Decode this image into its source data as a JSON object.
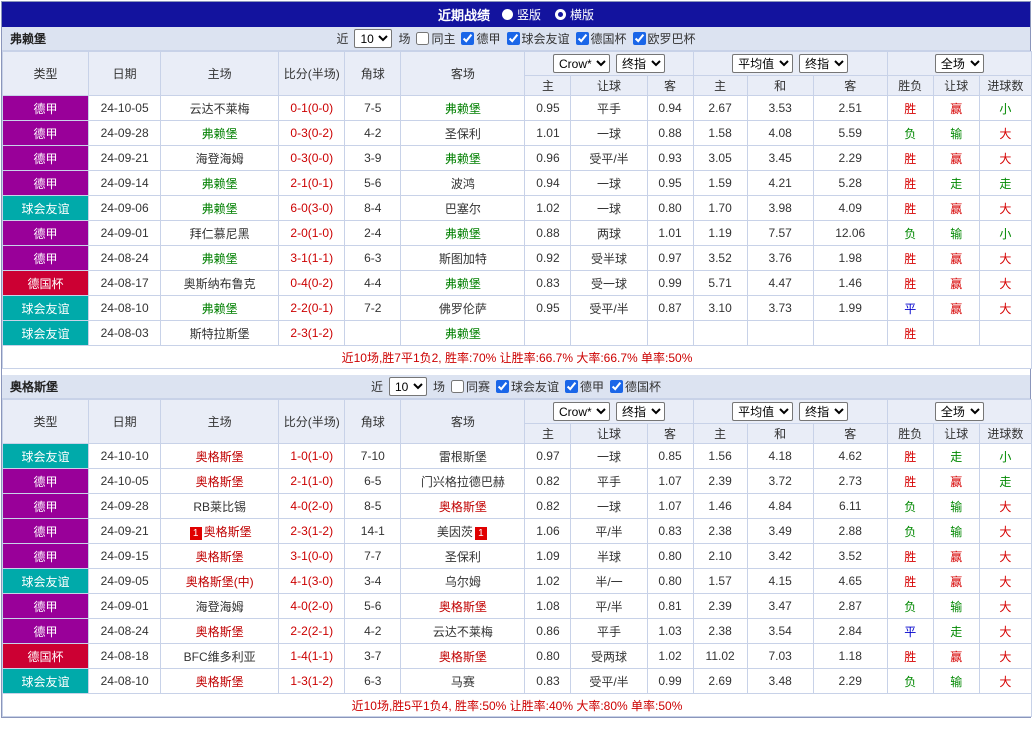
{
  "title_bar": {
    "title": "近期战绩",
    "radios": [
      {
        "label": "竖版",
        "selected": false
      },
      {
        "label": "横版",
        "selected": true
      }
    ]
  },
  "columns": {
    "type": "类型",
    "date": "日期",
    "home": "主场",
    "score": "比分(半场)",
    "corner": "角球",
    "away": "客场",
    "odds_home": "主",
    "odds_hand": "让球",
    "odds_away": "客",
    "eu_home": "主",
    "eu_draw": "和",
    "eu_away": "客",
    "res_wl": "胜负",
    "res_handicap": "让球",
    "res_goals": "进球数"
  },
  "selects": {
    "odds_company": "Crow*",
    "odds_stage": "终指",
    "eu_company": "平均值",
    "eu_stage": "终指",
    "scope": "全场"
  },
  "type_colors": {
    "德甲": "#990099",
    "球会友谊": "#00AAAA",
    "德国杯": "#CC0033"
  },
  "result_colors": {
    "red": "#D60000",
    "green": "#008800",
    "blue": "#0000CC"
  },
  "sections": [
    {
      "team": "弗赖堡",
      "focus_color": "#008000",
      "filter": {
        "prefix": "近",
        "count": "10",
        "suffix": "场",
        "same_label": "同主",
        "same_checked": false,
        "leagues": [
          {
            "label": "德甲",
            "checked": true
          },
          {
            "label": "球会友谊",
            "checked": true
          },
          {
            "label": "德国杯",
            "checked": true
          },
          {
            "label": "欧罗巴杯",
            "checked": true
          }
        ]
      },
      "rows": [
        {
          "type": "德甲",
          "date": "24-10-05",
          "home": "云达不莱梅",
          "home_focus": false,
          "home_badge": "",
          "score": "0-1(0-0)",
          "corner": "7-5",
          "away": "弗赖堡",
          "away_focus": true,
          "away_badge": "",
          "odds_home": "0.95",
          "odds_hand": "平手",
          "odds_away": "0.94",
          "eu_home": "2.67",
          "eu_draw": "3.53",
          "eu_away": "2.51",
          "res_wl": "胜",
          "res_wl_c": "red",
          "res_hd": "赢",
          "res_hd_c": "red",
          "res_gl": "小",
          "res_gl_c": "green"
        },
        {
          "type": "德甲",
          "date": "24-09-28",
          "home": "弗赖堡",
          "home_focus": true,
          "home_badge": "",
          "score": "0-3(0-2)",
          "corner": "4-2",
          "away": "圣保利",
          "away_focus": false,
          "away_badge": "",
          "odds_home": "1.01",
          "odds_hand": "一球",
          "odds_away": "0.88",
          "eu_home": "1.58",
          "eu_draw": "4.08",
          "eu_away": "5.59",
          "res_wl": "负",
          "res_wl_c": "green",
          "res_hd": "输",
          "res_hd_c": "green",
          "res_gl": "大",
          "res_gl_c": "red"
        },
        {
          "type": "德甲",
          "date": "24-09-21",
          "home": "海登海姆",
          "home_focus": false,
          "home_badge": "",
          "score": "0-3(0-0)",
          "corner": "3-9",
          "away": "弗赖堡",
          "away_focus": true,
          "away_badge": "",
          "odds_home": "0.96",
          "odds_hand": "受平/半",
          "odds_away": "0.93",
          "eu_home": "3.05",
          "eu_draw": "3.45",
          "eu_away": "2.29",
          "res_wl": "胜",
          "res_wl_c": "red",
          "res_hd": "赢",
          "res_hd_c": "red",
          "res_gl": "大",
          "res_gl_c": "red"
        },
        {
          "type": "德甲",
          "date": "24-09-14",
          "home": "弗赖堡",
          "home_focus": true,
          "home_badge": "",
          "score": "2-1(0-1)",
          "corner": "5-6",
          "away": "波鸿",
          "away_focus": false,
          "away_badge": "",
          "odds_home": "0.94",
          "odds_hand": "一球",
          "odds_away": "0.95",
          "eu_home": "1.59",
          "eu_draw": "4.21",
          "eu_away": "5.28",
          "res_wl": "胜",
          "res_wl_c": "red",
          "res_hd": "走",
          "res_hd_c": "green",
          "res_gl": "走",
          "res_gl_c": "green"
        },
        {
          "type": "球会友谊",
          "date": "24-09-06",
          "home": "弗赖堡",
          "home_focus": true,
          "home_badge": "",
          "score": "6-0(3-0)",
          "corner": "8-4",
          "away": "巴塞尔",
          "away_focus": false,
          "away_badge": "",
          "odds_home": "1.02",
          "odds_hand": "一球",
          "odds_away": "0.80",
          "eu_home": "1.70",
          "eu_draw": "3.98",
          "eu_away": "4.09",
          "res_wl": "胜",
          "res_wl_c": "red",
          "res_hd": "赢",
          "res_hd_c": "red",
          "res_gl": "大",
          "res_gl_c": "red"
        },
        {
          "type": "德甲",
          "date": "24-09-01",
          "home": "拜仁慕尼黑",
          "home_focus": false,
          "home_badge": "",
          "score": "2-0(1-0)",
          "corner": "2-4",
          "away": "弗赖堡",
          "away_focus": true,
          "away_badge": "",
          "odds_home": "0.88",
          "odds_hand": "两球",
          "odds_away": "1.01",
          "eu_home": "1.19",
          "eu_draw": "7.57",
          "eu_away": "12.06",
          "res_wl": "负",
          "res_wl_c": "green",
          "res_hd": "输",
          "res_hd_c": "green",
          "res_gl": "小",
          "res_gl_c": "green"
        },
        {
          "type": "德甲",
          "date": "24-08-24",
          "home": "弗赖堡",
          "home_focus": true,
          "home_badge": "",
          "score": "3-1(1-1)",
          "corner": "6-3",
          "away": "斯图加特",
          "away_focus": false,
          "away_badge": "",
          "odds_home": "0.92",
          "odds_hand": "受半球",
          "odds_away": "0.97",
          "eu_home": "3.52",
          "eu_draw": "3.76",
          "eu_away": "1.98",
          "res_wl": "胜",
          "res_wl_c": "red",
          "res_hd": "赢",
          "res_hd_c": "red",
          "res_gl": "大",
          "res_gl_c": "red"
        },
        {
          "type": "德国杯",
          "date": "24-08-17",
          "home": "奥斯纳布鲁克",
          "home_focus": false,
          "home_badge": "",
          "score": "0-4(0-2)",
          "corner": "4-4",
          "away": "弗赖堡",
          "away_focus": true,
          "away_badge": "",
          "odds_home": "0.83",
          "odds_hand": "受一球",
          "odds_away": "0.99",
          "eu_home": "5.71",
          "eu_draw": "4.47",
          "eu_away": "1.46",
          "res_wl": "胜",
          "res_wl_c": "red",
          "res_hd": "赢",
          "res_hd_c": "red",
          "res_gl": "大",
          "res_gl_c": "red"
        },
        {
          "type": "球会友谊",
          "date": "24-08-10",
          "home": "弗赖堡",
          "home_focus": true,
          "home_badge": "",
          "score": "2-2(0-1)",
          "corner": "7-2",
          "away": "佛罗伦萨",
          "away_focus": false,
          "away_badge": "",
          "odds_home": "0.95",
          "odds_hand": "受平/半",
          "odds_away": "0.87",
          "eu_home": "3.10",
          "eu_draw": "3.73",
          "eu_away": "1.99",
          "res_wl": "平",
          "res_wl_c": "blue",
          "res_hd": "赢",
          "res_hd_c": "red",
          "res_gl": "大",
          "res_gl_c": "red"
        },
        {
          "type": "球会友谊",
          "date": "24-08-03",
          "home": "斯特拉斯堡",
          "home_focus": false,
          "home_badge": "",
          "score": "2-3(1-2)",
          "corner": "",
          "away": "弗赖堡",
          "away_focus": true,
          "away_badge": "",
          "odds_home": "",
          "odds_hand": "",
          "odds_away": "",
          "eu_home": "",
          "eu_draw": "",
          "eu_away": "",
          "res_wl": "胜",
          "res_wl_c": "red",
          "res_hd": "",
          "res_hd_c": "",
          "res_gl": "",
          "res_gl_c": ""
        }
      ],
      "summary": "近10场,胜7平1负2, 胜率:70% 让胜率:66.7% 大率:66.7% 单率:50%"
    },
    {
      "team": "奥格斯堡",
      "focus_color": "#C00000",
      "filter": {
        "prefix": "近",
        "count": "10",
        "suffix": "场",
        "same_label": "同赛",
        "same_checked": false,
        "leagues": [
          {
            "label": "球会友谊",
            "checked": true
          },
          {
            "label": "德甲",
            "checked": true
          },
          {
            "label": "德国杯",
            "checked": true
          }
        ]
      },
      "rows": [
        {
          "type": "球会友谊",
          "date": "24-10-10",
          "home": "奥格斯堡",
          "home_focus": true,
          "home_badge": "",
          "score": "1-0(1-0)",
          "corner": "7-10",
          "away": "雷根斯堡",
          "away_focus": false,
          "away_badge": "",
          "odds_home": "0.97",
          "odds_hand": "一球",
          "odds_away": "0.85",
          "eu_home": "1.56",
          "eu_draw": "4.18",
          "eu_away": "4.62",
          "res_wl": "胜",
          "res_wl_c": "red",
          "res_hd": "走",
          "res_hd_c": "green",
          "res_gl": "小",
          "res_gl_c": "green"
        },
        {
          "type": "德甲",
          "date": "24-10-05",
          "home": "奥格斯堡",
          "home_focus": true,
          "home_badge": "",
          "score": "2-1(1-0)",
          "corner": "6-5",
          "away": "门兴格拉德巴赫",
          "away_focus": false,
          "away_badge": "",
          "odds_home": "0.82",
          "odds_hand": "平手",
          "odds_away": "1.07",
          "eu_home": "2.39",
          "eu_draw": "3.72",
          "eu_away": "2.73",
          "res_wl": "胜",
          "res_wl_c": "red",
          "res_hd": "赢",
          "res_hd_c": "red",
          "res_gl": "走",
          "res_gl_c": "green"
        },
        {
          "type": "德甲",
          "date": "24-09-28",
          "home": "RB莱比锡",
          "home_focus": false,
          "home_badge": "",
          "score": "4-0(2-0)",
          "corner": "8-5",
          "away": "奥格斯堡",
          "away_focus": true,
          "away_badge": "",
          "odds_home": "0.82",
          "odds_hand": "一球",
          "odds_away": "1.07",
          "eu_home": "1.46",
          "eu_draw": "4.84",
          "eu_away": "6.11",
          "res_wl": "负",
          "res_wl_c": "green",
          "res_hd": "输",
          "res_hd_c": "green",
          "res_gl": "大",
          "res_gl_c": "red"
        },
        {
          "type": "德甲",
          "date": "24-09-21",
          "home": "奥格斯堡",
          "home_focus": true,
          "home_badge": "1",
          "score": "2-3(1-2)",
          "corner": "14-1",
          "away": "美因茨",
          "away_focus": false,
          "away_badge": "1",
          "odds_home": "1.06",
          "odds_hand": "平/半",
          "odds_away": "0.83",
          "eu_home": "2.38",
          "eu_draw": "3.49",
          "eu_away": "2.88",
          "res_wl": "负",
          "res_wl_c": "green",
          "res_hd": "输",
          "res_hd_c": "green",
          "res_gl": "大",
          "res_gl_c": "red"
        },
        {
          "type": "德甲",
          "date": "24-09-15",
          "home": "奥格斯堡",
          "home_focus": true,
          "home_badge": "",
          "score": "3-1(0-0)",
          "corner": "7-7",
          "away": "圣保利",
          "away_focus": false,
          "away_badge": "",
          "odds_home": "1.09",
          "odds_hand": "半球",
          "odds_away": "0.80",
          "eu_home": "2.10",
          "eu_draw": "3.42",
          "eu_away": "3.52",
          "res_wl": "胜",
          "res_wl_c": "red",
          "res_hd": "赢",
          "res_hd_c": "red",
          "res_gl": "大",
          "res_gl_c": "red"
        },
        {
          "type": "球会友谊",
          "date": "24-09-05",
          "home": "奥格斯堡(中)",
          "home_focus": true,
          "home_badge": "",
          "score": "4-1(3-0)",
          "corner": "3-4",
          "away": "乌尔姆",
          "away_focus": false,
          "away_badge": "",
          "odds_home": "1.02",
          "odds_hand": "半/一",
          "odds_away": "0.80",
          "eu_home": "1.57",
          "eu_draw": "4.15",
          "eu_away": "4.65",
          "res_wl": "胜",
          "res_wl_c": "red",
          "res_hd": "赢",
          "res_hd_c": "red",
          "res_gl": "大",
          "res_gl_c": "red"
        },
        {
          "type": "德甲",
          "date": "24-09-01",
          "home": "海登海姆",
          "home_focus": false,
          "home_badge": "",
          "score": "4-0(2-0)",
          "corner": "5-6",
          "away": "奥格斯堡",
          "away_focus": true,
          "away_badge": "",
          "odds_home": "1.08",
          "odds_hand": "平/半",
          "odds_away": "0.81",
          "eu_home": "2.39",
          "eu_draw": "3.47",
          "eu_away": "2.87",
          "res_wl": "负",
          "res_wl_c": "green",
          "res_hd": "输",
          "res_hd_c": "green",
          "res_gl": "大",
          "res_gl_c": "red"
        },
        {
          "type": "德甲",
          "date": "24-08-24",
          "home": "奥格斯堡",
          "home_focus": true,
          "home_badge": "",
          "score": "2-2(2-1)",
          "corner": "4-2",
          "away": "云达不莱梅",
          "away_focus": false,
          "away_badge": "",
          "odds_home": "0.86",
          "odds_hand": "平手",
          "odds_away": "1.03",
          "eu_home": "2.38",
          "eu_draw": "3.54",
          "eu_away": "2.84",
          "res_wl": "平",
          "res_wl_c": "blue",
          "res_hd": "走",
          "res_hd_c": "green",
          "res_gl": "大",
          "res_gl_c": "red"
        },
        {
          "type": "德国杯",
          "date": "24-08-18",
          "home": "BFC维多利亚",
          "home_focus": false,
          "home_badge": "",
          "score": "1-4(1-1)",
          "corner": "3-7",
          "away": "奥格斯堡",
          "away_focus": true,
          "away_badge": "",
          "odds_home": "0.80",
          "odds_hand": "受两球",
          "odds_away": "1.02",
          "eu_home": "11.02",
          "eu_draw": "7.03",
          "eu_away": "1.18",
          "res_wl": "胜",
          "res_wl_c": "red",
          "res_hd": "赢",
          "res_hd_c": "red",
          "res_gl": "大",
          "res_gl_c": "red"
        },
        {
          "type": "球会友谊",
          "date": "24-08-10",
          "home": "奥格斯堡",
          "home_focus": true,
          "home_badge": "",
          "score": "1-3(1-2)",
          "corner": "6-3",
          "away": "马赛",
          "away_focus": false,
          "away_badge": "",
          "odds_home": "0.83",
          "odds_hand": "受平/半",
          "odds_away": "0.99",
          "eu_home": "2.69",
          "eu_draw": "3.48",
          "eu_away": "2.29",
          "res_wl": "负",
          "res_wl_c": "green",
          "res_hd": "输",
          "res_hd_c": "green",
          "res_gl": "大",
          "res_gl_c": "red"
        }
      ],
      "summary": "近10场,胜5平1负4, 胜率:50% 让胜率:40% 大率:80% 单率:50%"
    }
  ]
}
